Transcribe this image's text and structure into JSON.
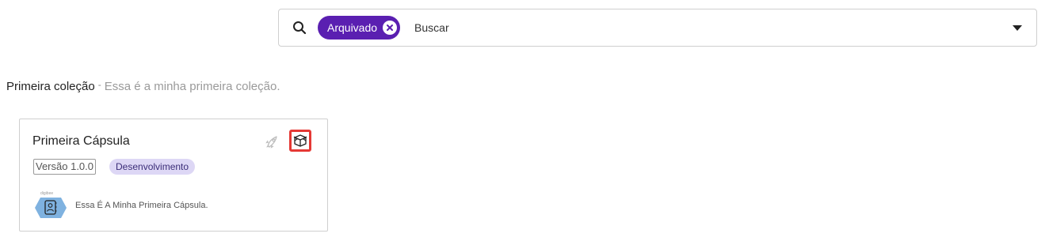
{
  "search": {
    "filter_chip_label": "Arquivado",
    "placeholder": "Buscar"
  },
  "collection": {
    "name": "Primeira coleção",
    "separator": "-",
    "description": "Essa é a minha primeira coleção."
  },
  "card": {
    "title": "Primeira Cápsula",
    "version": "Versão 1.0.0",
    "status": "Desenvolvimento",
    "description": "Essa É A Minha Primeira Cápsula.",
    "logo_brand": "digibee"
  },
  "icons": {
    "search": "search-icon",
    "chip_close": "close-circle-icon",
    "dropdown": "caret-down-icon",
    "deploy": "rocket-icon",
    "archive": "box-icon"
  },
  "colors": {
    "chip_bg": "#5a1fb1",
    "badge_bg": "#ddd7f5",
    "highlight": "#e53935",
    "logo_bg": "#7fb2e0"
  }
}
